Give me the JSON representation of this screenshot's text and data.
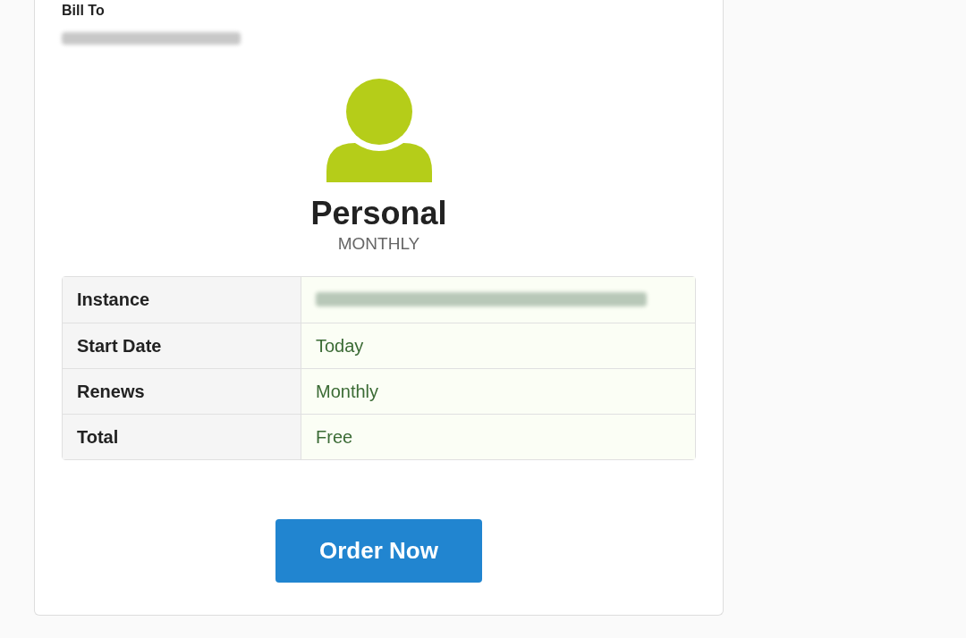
{
  "bill_to": {
    "heading": "Bill To"
  },
  "plan": {
    "name": "Personal",
    "cycle": "MONTHLY"
  },
  "details": [
    {
      "label": "Instance",
      "redacted": true
    },
    {
      "label": "Start Date",
      "redacted": false,
      "value": "Today"
    },
    {
      "label": "Renews",
      "redacted": false,
      "value": "Monthly"
    },
    {
      "label": "Total",
      "redacted": false,
      "value": "Free"
    }
  ],
  "order_button": {
    "label": "Order Now"
  }
}
